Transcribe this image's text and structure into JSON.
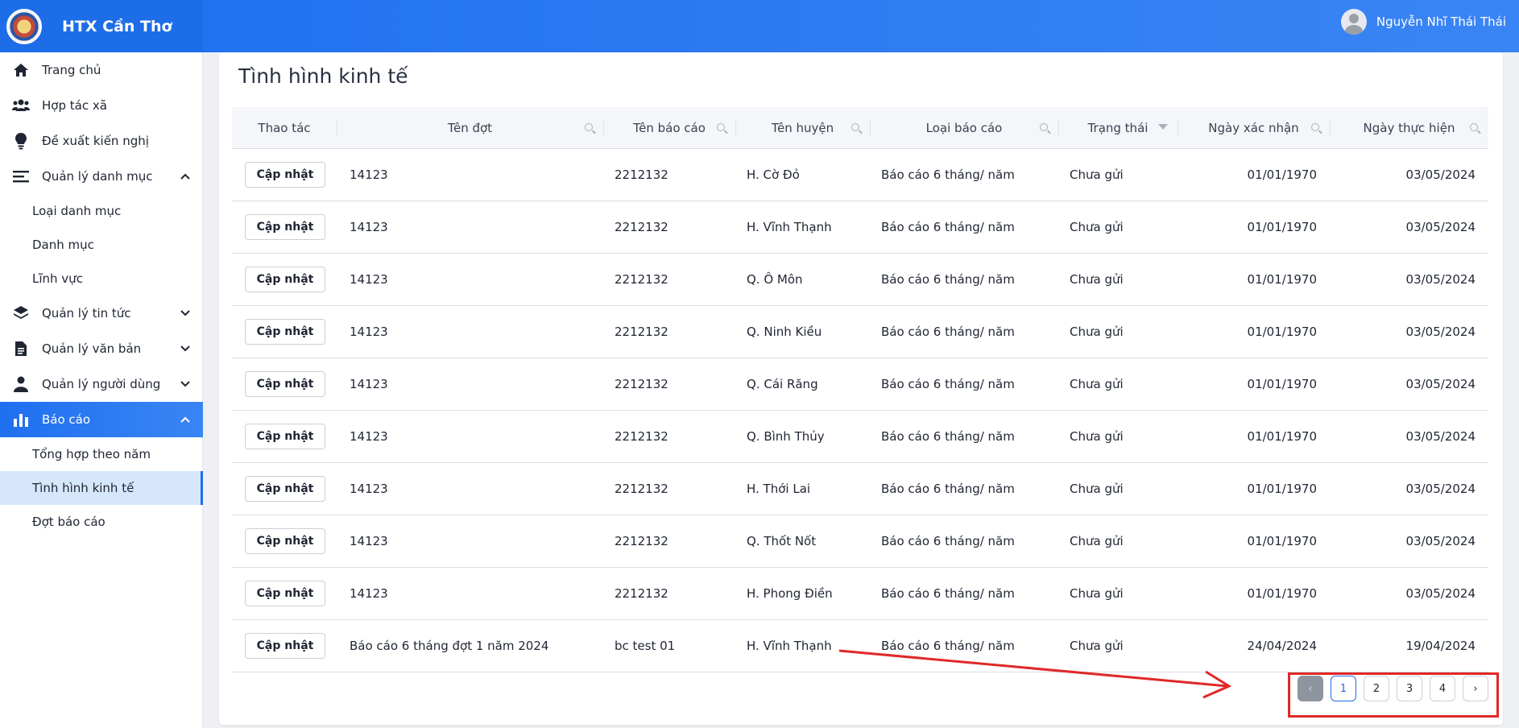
{
  "app": {
    "brand": "HTX Cần Thơ",
    "user_name": "Nguyễn Nhĩ Thái Thái"
  },
  "sidebar": {
    "items": [
      {
        "label": "Trang chủ",
        "icon": "home-icon"
      },
      {
        "label": "Hợp tác xã",
        "icon": "users-icon"
      },
      {
        "label": "Đề xuất kiến nghị",
        "icon": "lightbulb-icon"
      },
      {
        "label": "Quản lý danh mục",
        "icon": "list-icon",
        "expanded": true
      },
      {
        "label": "Quản lý tin tức",
        "icon": "layers-icon",
        "expanded": false
      },
      {
        "label": "Quản lý văn bản",
        "icon": "document-icon",
        "expanded": false
      },
      {
        "label": "Quản lý người dùng",
        "icon": "user-icon",
        "expanded": false
      },
      {
        "label": "Báo cáo",
        "icon": "bar-chart-icon",
        "expanded": true
      }
    ],
    "danh_muc_sub": [
      "Loại danh mục",
      "Danh mục",
      "Lĩnh vực"
    ],
    "bao_cao_sub": [
      "Tổng hợp theo năm",
      "Tình hình kinh tế",
      "Đợt báo cáo"
    ]
  },
  "page": {
    "title": "Tình hình kinh tế"
  },
  "table": {
    "columns": [
      "Thao tác",
      "Tên đợt",
      "Tên báo cáo",
      "Tên huyện",
      "Loại báo cáo",
      "Trạng thái",
      "Ngày xác nhận",
      "Ngày thực hiện"
    ],
    "action_label": "Cập nhật",
    "rows": [
      [
        "14123",
        "2212132",
        "H. Cờ Đỏ",
        "Báo cáo 6 tháng/ năm",
        "Chưa gửi",
        "01/01/1970",
        "03/05/2024"
      ],
      [
        "14123",
        "2212132",
        "H. Vĩnh Thạnh",
        "Báo cáo 6 tháng/ năm",
        "Chưa gửi",
        "01/01/1970",
        "03/05/2024"
      ],
      [
        "14123",
        "2212132",
        "Q. Ô Môn",
        "Báo cáo 6 tháng/ năm",
        "Chưa gửi",
        "01/01/1970",
        "03/05/2024"
      ],
      [
        "14123",
        "2212132",
        "Q. Ninh Kiều",
        "Báo cáo 6 tháng/ năm",
        "Chưa gửi",
        "01/01/1970",
        "03/05/2024"
      ],
      [
        "14123",
        "2212132",
        "Q. Cái Răng",
        "Báo cáo 6 tháng/ năm",
        "Chưa gửi",
        "01/01/1970",
        "03/05/2024"
      ],
      [
        "14123",
        "2212132",
        "Q. Bình Thủy",
        "Báo cáo 6 tháng/ năm",
        "Chưa gửi",
        "01/01/1970",
        "03/05/2024"
      ],
      [
        "14123",
        "2212132",
        "H. Thới Lai",
        "Báo cáo 6 tháng/ năm",
        "Chưa gửi",
        "01/01/1970",
        "03/05/2024"
      ],
      [
        "14123",
        "2212132",
        "Q. Thốt Nốt",
        "Báo cáo 6 tháng/ năm",
        "Chưa gửi",
        "01/01/1970",
        "03/05/2024"
      ],
      [
        "14123",
        "2212132",
        "H. Phong Điền",
        "Báo cáo 6 tháng/ năm",
        "Chưa gửi",
        "01/01/1970",
        "03/05/2024"
      ],
      [
        "Báo cáo 6 tháng đợt 1 năm 2024",
        "bc test 01",
        "H. Vĩnh Thạnh",
        "Báo cáo 6 tháng/ năm",
        "Chưa gửi",
        "24/04/2024",
        "19/04/2024"
      ]
    ]
  },
  "pagination": {
    "pages": [
      "1",
      "2",
      "3",
      "4"
    ],
    "current": "1",
    "prev": "‹",
    "next": "›"
  },
  "colors": {
    "primary": "#1d6de9",
    "annotation": "#e02828"
  }
}
